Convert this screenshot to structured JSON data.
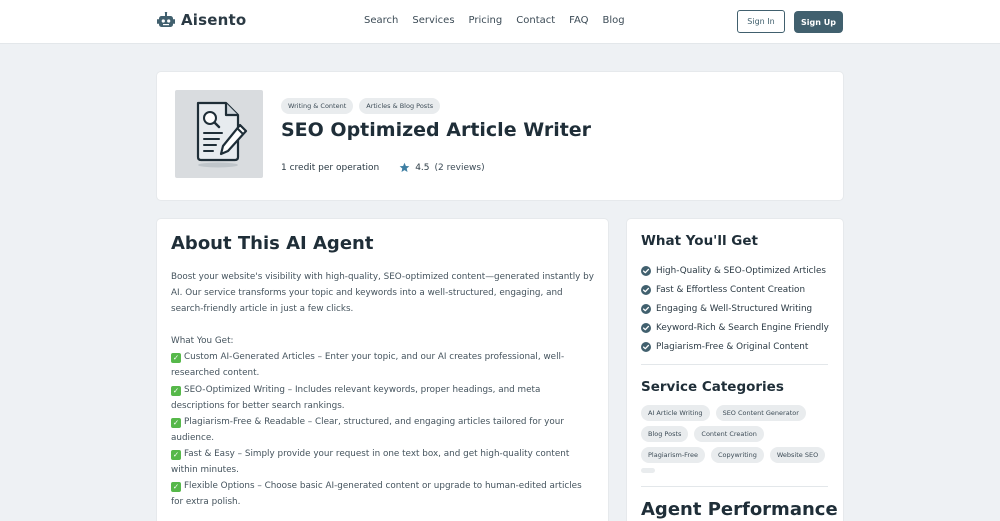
{
  "brand": {
    "name": "Aisento",
    "icon": "robot-icon"
  },
  "nav": {
    "links": [
      "Search",
      "Services",
      "Pricing",
      "Contact",
      "FAQ",
      "Blog"
    ],
    "sign_in": "Sign In",
    "sign_up": "Sign Up"
  },
  "hero": {
    "tags": [
      "Writing & Content",
      "Articles & Blog Posts"
    ],
    "title": "SEO Optimized Article Writer",
    "credit": "1 credit per operation",
    "rating": "4.5",
    "reviews": "(2 reviews)",
    "thumb_icon": "document-pen-icon"
  },
  "about": {
    "title": "About This AI Agent",
    "intro": "Boost your website's visibility with high-quality, SEO-optimized content—generated instantly by AI. Our service transforms your topic and keywords into a well-structured, engaging, and search-friendly article in just a few clicks.",
    "features_heading": "What You Get:",
    "features": [
      "Custom AI-Generated Articles – Enter your topic, and our AI creates professional, well-researched content.",
      "SEO-Optimized Writing – Includes relevant keywords, proper headings, and meta descriptions for better search rankings.",
      "Plagiarism-Free & Readable – Clear, structured, and engaging articles tailored for your audience.",
      "Fast & Easy – Simply provide your request in one text box, and get high-quality content within minutes.",
      "Flexible Options – Choose basic AI-generated content or upgrade to human-edited articles for extra polish."
    ],
    "check_glyph": "✓"
  },
  "sidebar": {
    "get_title": "What You'll Get",
    "get_items": [
      "High-Quality & SEO-Optimized Articles",
      "Fast & Effortless Content Creation",
      "Engaging & Well-Structured Writing",
      "Keyword-Rich & Search Engine Friendly",
      "Plagiarism-Free & Original Content"
    ],
    "categories_title": "Service Categories",
    "categories": [
      "AI Article Writing",
      "SEO Content Generator",
      "Blog Posts",
      "Content Creation",
      "Plagiarism-Free",
      "Copywriting",
      "Website SEO"
    ],
    "performance_title": "Agent Performance"
  },
  "colors": {
    "accent": "#41606e",
    "check_green": "#56b84a",
    "star_blue": "#3f7fa3"
  }
}
